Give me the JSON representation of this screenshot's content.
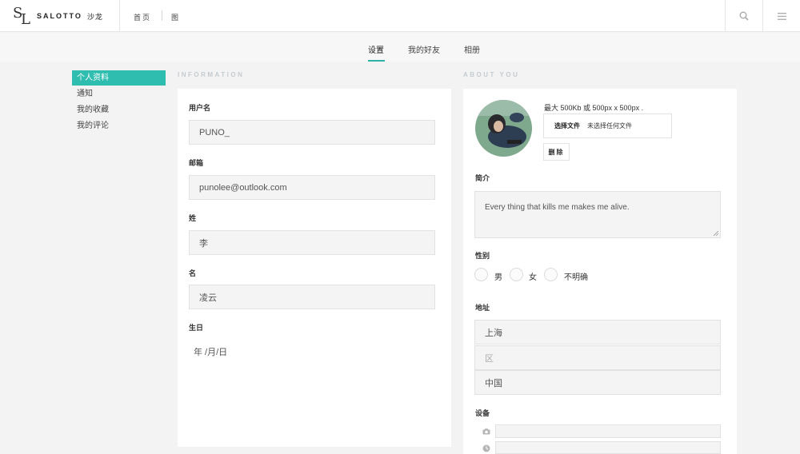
{
  "brand": {
    "name": "SALOTTO",
    "name_cn": "沙龙",
    "logo_letters": "SL"
  },
  "nav": {
    "home": "首页",
    "pictures": "图"
  },
  "icons": {
    "search": "search-icon",
    "menu": "menu-icon",
    "camera": "camera-icon",
    "clock": "clock-icon"
  },
  "tabs": [
    {
      "label": "设置",
      "active": true
    },
    {
      "label": "我的好友",
      "active": false
    },
    {
      "label": "相册",
      "active": false
    }
  ],
  "sidebar": {
    "items": [
      {
        "label": "个人资料",
        "active": true
      },
      {
        "label": "通知",
        "active": false
      },
      {
        "label": "我的收藏",
        "active": false
      },
      {
        "label": "我的评论",
        "active": false
      }
    ]
  },
  "information": {
    "heading": "INFORMATION",
    "username_label": "用户名",
    "username_value": "PUNO_",
    "email_label": "邮箱",
    "email_value": "punolee@outlook.com",
    "lastname_label": "姓",
    "lastname_value": "李",
    "firstname_label": "名",
    "firstname_value": "凌云",
    "birthday_label": "生日",
    "birthday_value": "年 /月/日"
  },
  "about": {
    "heading": "ABOUT YOU",
    "avatar_hint": "最大 500Kb 或 500px x 500px .",
    "choose_file": "选择文件",
    "no_file": "未选择任何文件",
    "delete": "删除",
    "bio_label": "简介",
    "bio_value": "Every thing that kills me makes me alive.",
    "gender_label": "性别",
    "gender_options": [
      "男",
      "女",
      "不明确"
    ],
    "address_label": "地址",
    "address_city": "上海",
    "address_district_placeholder": "区",
    "address_country": "中国",
    "devices_label": "设备"
  },
  "colors": {
    "accent": "#2fbdaf",
    "background": "#f3f3f3"
  }
}
